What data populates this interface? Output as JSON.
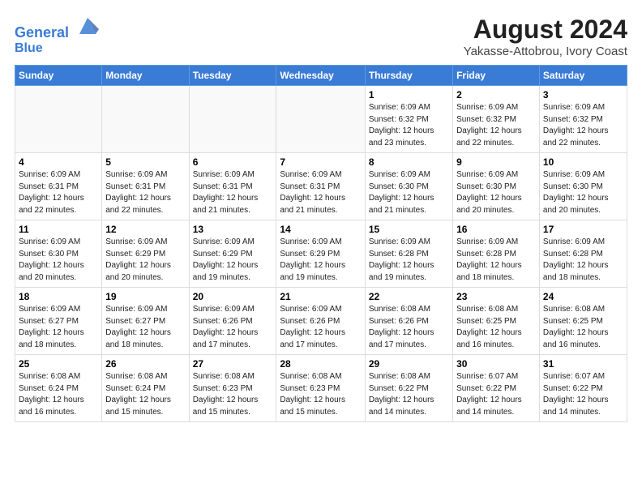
{
  "header": {
    "logo_line1": "General",
    "logo_line2": "Blue",
    "main_title": "August 2024",
    "subtitle": "Yakasse-Attobrou, Ivory Coast"
  },
  "days_of_week": [
    "Sunday",
    "Monday",
    "Tuesday",
    "Wednesday",
    "Thursday",
    "Friday",
    "Saturday"
  ],
  "weeks": [
    [
      {
        "day": "",
        "info": ""
      },
      {
        "day": "",
        "info": ""
      },
      {
        "day": "",
        "info": ""
      },
      {
        "day": "",
        "info": ""
      },
      {
        "day": "1",
        "info": "Sunrise: 6:09 AM\nSunset: 6:32 PM\nDaylight: 12 hours\nand 23 minutes."
      },
      {
        "day": "2",
        "info": "Sunrise: 6:09 AM\nSunset: 6:32 PM\nDaylight: 12 hours\nand 22 minutes."
      },
      {
        "day": "3",
        "info": "Sunrise: 6:09 AM\nSunset: 6:32 PM\nDaylight: 12 hours\nand 22 minutes."
      }
    ],
    [
      {
        "day": "4",
        "info": "Sunrise: 6:09 AM\nSunset: 6:31 PM\nDaylight: 12 hours\nand 22 minutes."
      },
      {
        "day": "5",
        "info": "Sunrise: 6:09 AM\nSunset: 6:31 PM\nDaylight: 12 hours\nand 22 minutes."
      },
      {
        "day": "6",
        "info": "Sunrise: 6:09 AM\nSunset: 6:31 PM\nDaylight: 12 hours\nand 21 minutes."
      },
      {
        "day": "7",
        "info": "Sunrise: 6:09 AM\nSunset: 6:31 PM\nDaylight: 12 hours\nand 21 minutes."
      },
      {
        "day": "8",
        "info": "Sunrise: 6:09 AM\nSunset: 6:30 PM\nDaylight: 12 hours\nand 21 minutes."
      },
      {
        "day": "9",
        "info": "Sunrise: 6:09 AM\nSunset: 6:30 PM\nDaylight: 12 hours\nand 20 minutes."
      },
      {
        "day": "10",
        "info": "Sunrise: 6:09 AM\nSunset: 6:30 PM\nDaylight: 12 hours\nand 20 minutes."
      }
    ],
    [
      {
        "day": "11",
        "info": "Sunrise: 6:09 AM\nSunset: 6:30 PM\nDaylight: 12 hours\nand 20 minutes."
      },
      {
        "day": "12",
        "info": "Sunrise: 6:09 AM\nSunset: 6:29 PM\nDaylight: 12 hours\nand 20 minutes."
      },
      {
        "day": "13",
        "info": "Sunrise: 6:09 AM\nSunset: 6:29 PM\nDaylight: 12 hours\nand 19 minutes."
      },
      {
        "day": "14",
        "info": "Sunrise: 6:09 AM\nSunset: 6:29 PM\nDaylight: 12 hours\nand 19 minutes."
      },
      {
        "day": "15",
        "info": "Sunrise: 6:09 AM\nSunset: 6:28 PM\nDaylight: 12 hours\nand 19 minutes."
      },
      {
        "day": "16",
        "info": "Sunrise: 6:09 AM\nSunset: 6:28 PM\nDaylight: 12 hours\nand 18 minutes."
      },
      {
        "day": "17",
        "info": "Sunrise: 6:09 AM\nSunset: 6:28 PM\nDaylight: 12 hours\nand 18 minutes."
      }
    ],
    [
      {
        "day": "18",
        "info": "Sunrise: 6:09 AM\nSunset: 6:27 PM\nDaylight: 12 hours\nand 18 minutes."
      },
      {
        "day": "19",
        "info": "Sunrise: 6:09 AM\nSunset: 6:27 PM\nDaylight: 12 hours\nand 18 minutes."
      },
      {
        "day": "20",
        "info": "Sunrise: 6:09 AM\nSunset: 6:26 PM\nDaylight: 12 hours\nand 17 minutes."
      },
      {
        "day": "21",
        "info": "Sunrise: 6:09 AM\nSunset: 6:26 PM\nDaylight: 12 hours\nand 17 minutes."
      },
      {
        "day": "22",
        "info": "Sunrise: 6:08 AM\nSunset: 6:26 PM\nDaylight: 12 hours\nand 17 minutes."
      },
      {
        "day": "23",
        "info": "Sunrise: 6:08 AM\nSunset: 6:25 PM\nDaylight: 12 hours\nand 16 minutes."
      },
      {
        "day": "24",
        "info": "Sunrise: 6:08 AM\nSunset: 6:25 PM\nDaylight: 12 hours\nand 16 minutes."
      }
    ],
    [
      {
        "day": "25",
        "info": "Sunrise: 6:08 AM\nSunset: 6:24 PM\nDaylight: 12 hours\nand 16 minutes."
      },
      {
        "day": "26",
        "info": "Sunrise: 6:08 AM\nSunset: 6:24 PM\nDaylight: 12 hours\nand 15 minutes."
      },
      {
        "day": "27",
        "info": "Sunrise: 6:08 AM\nSunset: 6:23 PM\nDaylight: 12 hours\nand 15 minutes."
      },
      {
        "day": "28",
        "info": "Sunrise: 6:08 AM\nSunset: 6:23 PM\nDaylight: 12 hours\nand 15 minutes."
      },
      {
        "day": "29",
        "info": "Sunrise: 6:08 AM\nSunset: 6:22 PM\nDaylight: 12 hours\nand 14 minutes."
      },
      {
        "day": "30",
        "info": "Sunrise: 6:07 AM\nSunset: 6:22 PM\nDaylight: 12 hours\nand 14 minutes."
      },
      {
        "day": "31",
        "info": "Sunrise: 6:07 AM\nSunset: 6:22 PM\nDaylight: 12 hours\nand 14 minutes."
      }
    ]
  ]
}
